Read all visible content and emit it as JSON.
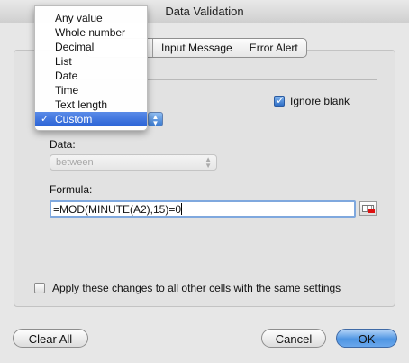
{
  "window": {
    "title": "Data Validation"
  },
  "tabs": [
    {
      "label": ""
    },
    {
      "label": "Input Message"
    },
    {
      "label": "Error Alert"
    }
  ],
  "allow": {
    "options": [
      "Any value",
      "Whole number",
      "Decimal",
      "List",
      "Date",
      "Time",
      "Text length",
      "Custom"
    ],
    "selected": "Custom",
    "check_mark": "✓"
  },
  "ignore_blank": {
    "label": "Ignore blank",
    "checked": true
  },
  "data": {
    "label": "Data:",
    "value": "between",
    "enabled": false
  },
  "formula": {
    "label": "Formula:",
    "value": "=MOD(MINUTE(A2),15)=0"
  },
  "apply_all": {
    "label": "Apply these changes to all other cells with the same settings",
    "checked": false
  },
  "buttons": {
    "clear_all": "Clear All",
    "cancel": "Cancel",
    "ok": "OK"
  },
  "colors": {
    "accent": "#2a63d6",
    "default_button": "#4f95e3"
  }
}
